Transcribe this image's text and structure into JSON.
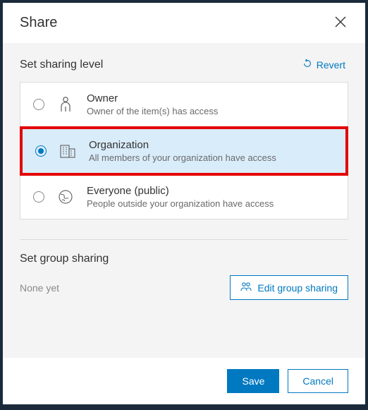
{
  "dialog": {
    "title": "Share"
  },
  "sharing_level": {
    "title": "Set sharing level",
    "revert_label": "Revert",
    "options": [
      {
        "id": "owner",
        "title": "Owner",
        "desc": "Owner of the item(s) has access",
        "selected": false
      },
      {
        "id": "organization",
        "title": "Organization",
        "desc": "All members of your organization have access",
        "selected": true
      },
      {
        "id": "public",
        "title": "Everyone (public)",
        "desc": "People outside your organization have access",
        "selected": false
      }
    ]
  },
  "group_sharing": {
    "title": "Set group sharing",
    "none_label": "None yet",
    "edit_label": "Edit group sharing"
  },
  "footer": {
    "save_label": "Save",
    "cancel_label": "Cancel"
  }
}
